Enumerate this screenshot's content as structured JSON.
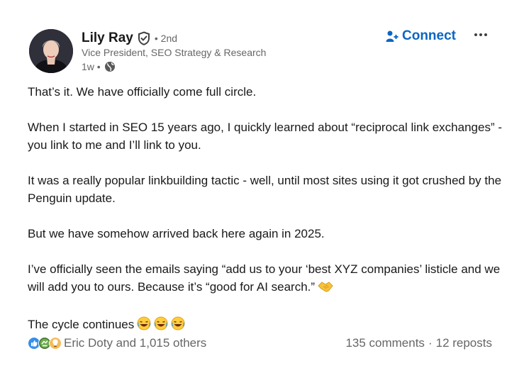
{
  "author": {
    "name": "Lily Ray",
    "degree": "• 2nd",
    "headline": "Vice President, SEO Strategy & Research",
    "time": "1w •",
    "verified_icon": "verified-shield-icon",
    "visibility_icon": "globe-icon"
  },
  "actions": {
    "connect_label": "Connect",
    "connect_icon": "person-add-icon",
    "more_icon": "more-horizontal-icon"
  },
  "post": {
    "paragraphs": [
      "That’s it. We have officially come full circle.",
      "When I started in SEO 15 years ago, I quickly learned about “reciprocal link exchanges” - you link to me and I’ll link to you.",
      "It was a really popular linkbuilding tactic - well, until most sites using it got crushed by the Penguin update.",
      "But we have somehow arrived back here again in 2025.",
      "I’ve officially seen the emails saying “add us to your ‘best XYZ companies’ listicle and we will add you to ours. Because it’s “good for AI search.”",
      "The cycle continues"
    ],
    "emojis": {
      "handshake": "handshake-emoji",
      "laughing": "laughing-emoji"
    }
  },
  "social": {
    "reactions_text": "Eric Doty and 1,015 others",
    "reaction_icons": [
      "like-icon",
      "celebrate-icon",
      "insightful-icon"
    ],
    "comments": "135 comments",
    "separator": "·",
    "reposts": "12 reposts"
  },
  "colors": {
    "link_blue": "#0a66c2",
    "text_primary": "#191919",
    "text_secondary": "#666666"
  }
}
